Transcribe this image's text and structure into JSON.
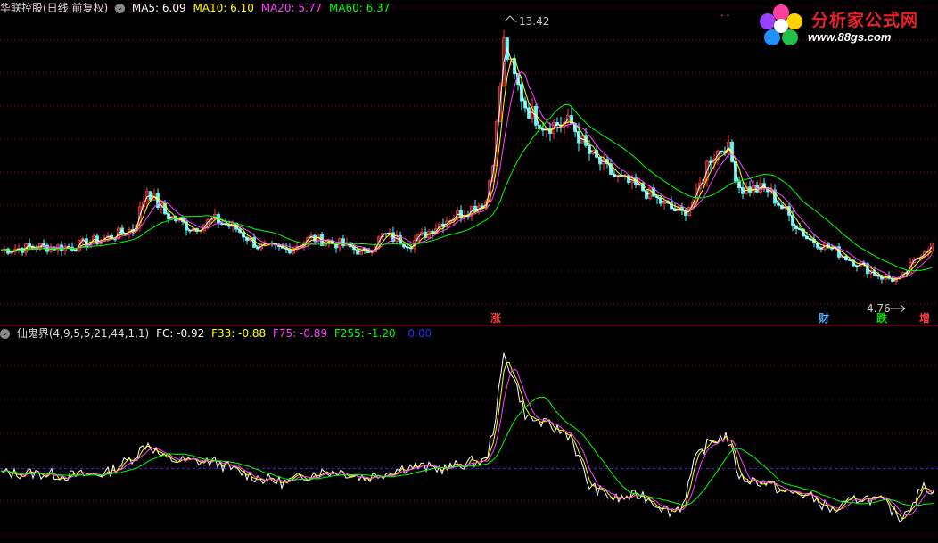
{
  "header": {
    "title": "华联控股(日线 前复权)",
    "ma5": "MA5: 6.09",
    "ma10": "MA10: 6.10",
    "ma20": "MA20: 5.77",
    "ma60": "MA60: 6.37"
  },
  "indicator_header": {
    "title": "仙鬼界(4,9,5,5,21,44,1,1)",
    "fc": "FC: -0.92",
    "f33": "F33: -0.88",
    "f75": "F75: -0.89",
    "f255": "F255: -1.20",
    "extra": "0.00"
  },
  "annotations": {
    "high": "13.42",
    "low": "4.76"
  },
  "signals": {
    "zhang": "涨",
    "cai": "财",
    "die": "跌",
    "zeng": "增"
  },
  "logo": {
    "title": "分析家公式网",
    "url": "www.88gs.com"
  },
  "colors": {
    "up": "#ff3b3b",
    "down": "#54ffff",
    "ma5": "#ffffff",
    "ma10": "#ffff00",
    "ma20": "#ff40ff",
    "ma60": "#00ff00",
    "grid": "#8b0000",
    "fc": "#ffffff",
    "f33": "#ffff00",
    "f75": "#ff40ff",
    "f255": "#00ff00",
    "extra": "#0000ff"
  },
  "chart_data": [
    {
      "type": "line",
      "subtype": "candlestick",
      "title": "华联控股(日线 前复权)",
      "x": [
        0,
        40,
        80,
        120,
        150,
        165,
        185,
        215,
        240,
        265,
        290,
        320,
        350,
        380,
        410,
        430,
        460,
        500,
        530,
        545,
        555,
        565,
        575,
        590,
        610,
        640,
        660,
        690,
        720,
        750,
        765,
        780,
        795,
        815,
        830,
        860,
        880,
        905,
        935,
        965,
        990,
        1010,
        1020,
        1035,
        1048
      ],
      "close": [
        5.9,
        6.0,
        6.0,
        6.3,
        6.6,
        7.9,
        7.1,
        6.6,
        6.9,
        6.6,
        6.0,
        5.9,
        6.3,
        6.1,
        5.8,
        6.4,
        6.1,
        6.9,
        7.3,
        7.5,
        9.3,
        12.7,
        11.7,
        10.6,
        10.0,
        10.1,
        9.1,
        8.3,
        7.9,
        7.3,
        7.1,
        7.6,
        8.9,
        9.4,
        7.9,
        7.9,
        7.2,
        6.3,
        5.9,
        5.4,
        5.0,
        4.9,
        5.3,
        5.9,
        6.1
      ],
      "ma_series": [
        {
          "name": "MA5",
          "value": "6.09"
        },
        {
          "name": "MA10",
          "value": "6.10"
        },
        {
          "name": "MA20",
          "value": "5.77"
        },
        {
          "name": "MA60",
          "value": "6.37"
        }
      ],
      "high": 13.42,
      "low": 4.76,
      "ylim": [
        4.0,
        13.9
      ]
    },
    {
      "type": "line",
      "title": "仙鬼界(4,9,5,5,21,44,1,1)",
      "x": [
        0,
        40,
        80,
        120,
        150,
        165,
        185,
        215,
        240,
        265,
        290,
        320,
        350,
        380,
        410,
        430,
        460,
        500,
        530,
        545,
        555,
        565,
        575,
        590,
        610,
        640,
        660,
        690,
        720,
        750,
        765,
        780,
        795,
        815,
        830,
        860,
        880,
        905,
        935,
        965,
        990,
        1010,
        1020,
        1035,
        1048
      ],
      "fc": [
        -0.2,
        -0.2,
        -0.3,
        -0.2,
        0.5,
        1.1,
        0.4,
        0.3,
        0.3,
        -0.1,
        -0.4,
        -0.6,
        -0.2,
        -0.1,
        -0.4,
        -0.2,
        0.1,
        0.0,
        0.3,
        0.3,
        2.0,
        4.8,
        4.0,
        2.2,
        1.9,
        1.4,
        -0.7,
        -1.3,
        -1.1,
        -1.8,
        -1.6,
        0.4,
        1.1,
        1.4,
        -0.4,
        -0.6,
        -1.0,
        -1.1,
        -1.8,
        -1.2,
        -1.4,
        -2.1,
        -1.6,
        -0.8,
        -0.9
      ],
      "series": [
        {
          "name": "FC",
          "value": "-0.92"
        },
        {
          "name": "F33",
          "value": "-0.88"
        },
        {
          "name": "F75",
          "value": "-0.89"
        },
        {
          "name": "F255",
          "value": "-1.20"
        }
      ],
      "reference_level": 0.0,
      "ylim": [
        -3.0,
        5.5
      ]
    }
  ]
}
